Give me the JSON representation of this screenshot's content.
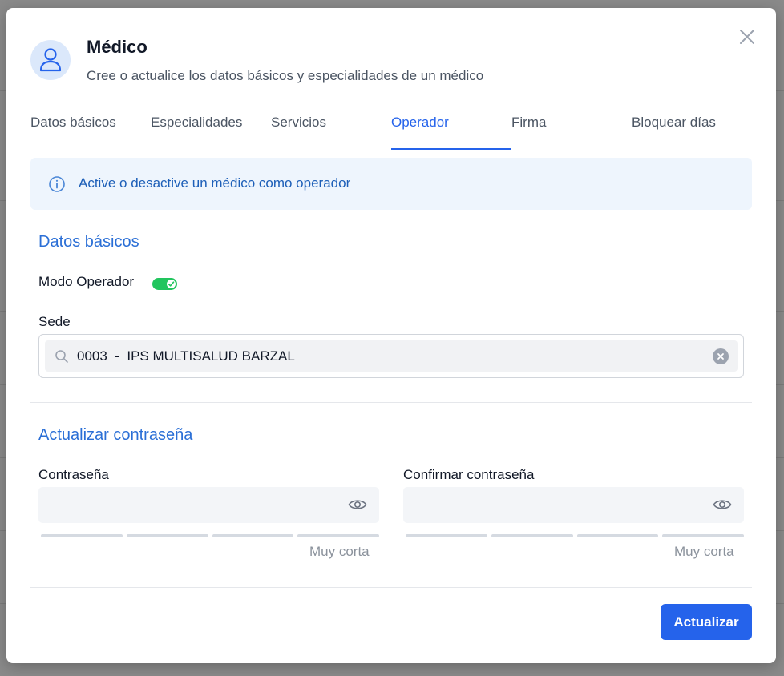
{
  "modal": {
    "title": "Médico",
    "subtitle": "Cree o actualice los datos básicos y especialidades de un médico"
  },
  "tabs": [
    {
      "label": "Datos básicos",
      "active": false
    },
    {
      "label": "Especialidades",
      "active": false
    },
    {
      "label": "Servicios",
      "active": false
    },
    {
      "label": "Operador",
      "active": true
    },
    {
      "label": "Firma",
      "active": false
    },
    {
      "label": "Bloquear días",
      "active": false
    }
  ],
  "info": {
    "text": "Active o desactive un médico como operador"
  },
  "basic_section": {
    "title": "Datos básicos",
    "mode_label": "Modo Operador",
    "mode_enabled": true,
    "sede_label": "Sede",
    "sede_value": "0003  -  IPS MULTISALUD BARZAL"
  },
  "password_section": {
    "title": "Actualizar contraseña",
    "password_label": "Contraseña",
    "password_value": "",
    "password_strength": "Muy corta",
    "confirm_label": "Confirmar contraseña",
    "confirm_value": "",
    "confirm_strength": "Muy corta"
  },
  "footer": {
    "submit_label": "Actualizar"
  },
  "colors": {
    "accent": "#2563eb",
    "toggle_on": "#22c55e",
    "info_bg": "#eef5fd"
  }
}
